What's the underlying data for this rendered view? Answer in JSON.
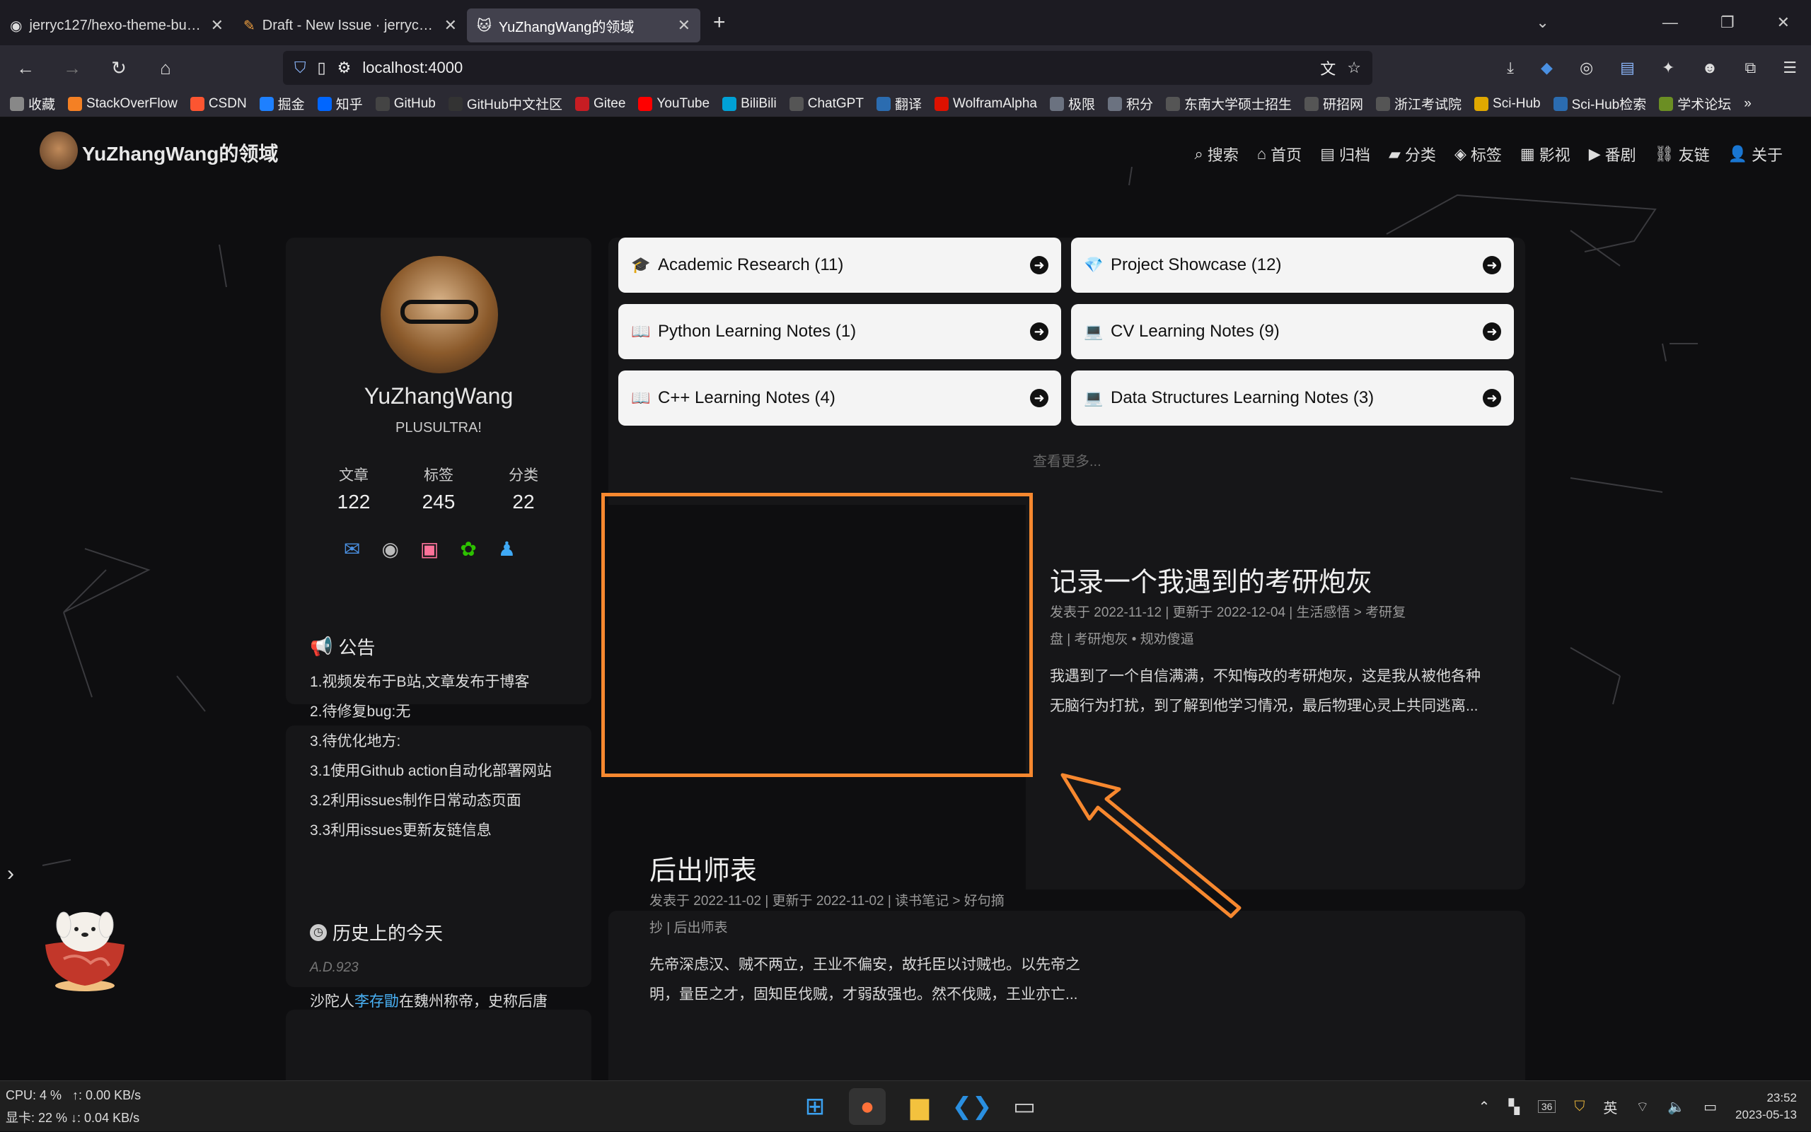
{
  "browser": {
    "tabs": [
      {
        "label": "jerryc127/hexo-theme-butterfly",
        "icon": "github-icon",
        "active": false
      },
      {
        "label": "Draft - New Issue · jerryc127/hexo-theme-butterfly",
        "icon": "pencil-icon",
        "active": false
      },
      {
        "label": "YuZhangWang的领域",
        "icon": "cat-icon",
        "active": true
      }
    ],
    "url": "localhost:4000",
    "bookmarks": [
      {
        "label": "收藏",
        "color": "#888"
      },
      {
        "label": "StackOverFlow",
        "color": "#f48024"
      },
      {
        "label": "CSDN",
        "color": "#fc5531"
      },
      {
        "label": "掘金",
        "color": "#1e80ff"
      },
      {
        "label": "知乎",
        "color": "#0066ff"
      },
      {
        "label": "GitHub",
        "color": "#444"
      },
      {
        "label": "GitHub中文社区",
        "color": "#333"
      },
      {
        "label": "Gitee",
        "color": "#c71d23"
      },
      {
        "label": "YouTube",
        "color": "#ff0000"
      },
      {
        "label": "BiliBili",
        "color": "#00a1d6"
      },
      {
        "label": "ChatGPT",
        "color": "#555"
      },
      {
        "label": "翻译",
        "color": "#2b6cb0"
      },
      {
        "label": "WolframAlpha",
        "color": "#dd1100"
      },
      {
        "label": "极限",
        "color": "#6b7280"
      },
      {
        "label": "积分",
        "color": "#6b7280"
      },
      {
        "label": "东南大学硕士招生",
        "color": "#555"
      },
      {
        "label": "研招网",
        "color": "#555"
      },
      {
        "label": "浙江考试院",
        "color": "#555"
      },
      {
        "label": "Sci-Hub",
        "color": "#e0a800"
      },
      {
        "label": "Sci-Hub检索",
        "color": "#2b6cb0"
      },
      {
        "label": "学术论坛",
        "color": "#6b8e23"
      }
    ]
  },
  "site": {
    "title": "YuZhangWang的领域",
    "menu": [
      {
        "label": "搜索",
        "icon": "search-icon",
        "glyph": "⌕"
      },
      {
        "label": "首页",
        "icon": "home-icon",
        "glyph": "⌂"
      },
      {
        "label": "归档",
        "icon": "archive-icon",
        "glyph": "▤"
      },
      {
        "label": "分类",
        "icon": "folder-icon",
        "glyph": "▰"
      },
      {
        "label": "标签",
        "icon": "tag-icon",
        "glyph": "◈"
      },
      {
        "label": "影视",
        "icon": "film-icon",
        "glyph": "▦"
      },
      {
        "label": "番剧",
        "icon": "tv-icon",
        "glyph": "▶"
      },
      {
        "label": "友链",
        "icon": "link-icon",
        "glyph": "⛓"
      },
      {
        "label": "关于",
        "icon": "user-icon",
        "glyph": "👤"
      }
    ]
  },
  "profile": {
    "name": "YuZhangWang",
    "motto": "PLUSULTRA!",
    "stats": [
      {
        "label": "文章",
        "value": "122"
      },
      {
        "label": "标签",
        "value": "245"
      },
      {
        "label": "分类",
        "value": "22"
      }
    ],
    "socials": [
      {
        "icon": "email-icon",
        "glyph": "✉",
        "color": "#4a90e2"
      },
      {
        "icon": "github-icon",
        "glyph": "◉",
        "color": "#bbbbbb"
      },
      {
        "icon": "bilibili-icon",
        "glyph": "▣",
        "color": "#fb7299"
      },
      {
        "icon": "wechat-icon",
        "glyph": "✿",
        "color": "#2dc100"
      },
      {
        "icon": "qq-icon",
        "glyph": "♟",
        "color": "#3fa9f5"
      }
    ]
  },
  "announcement": {
    "title": "公告",
    "lines": [
      "1.视频发布于B站,文章发布于博客",
      "2.待修复bug:无",
      "3.待优化地方:",
      "3.1使用Github action自动化部署网站",
      "3.2利用issues制作日常动态页面",
      "3.3利用issues更新友链信息"
    ]
  },
  "history": {
    "title": "历史上的今天",
    "date": "A.D.923",
    "text_prefix": "沙陀人",
    "text_link": "李存勖",
    "text_suffix": "在魏州称帝，史称后唐"
  },
  "categories": [
    {
      "label": "Academic Research (11)",
      "icon": "graduation-cap-icon",
      "glyph": "🎓"
    },
    {
      "label": "Project Showcase (12)",
      "icon": "gem-icon",
      "glyph": "💎"
    },
    {
      "label": "Python Learning Notes (1)",
      "icon": "book-icon",
      "glyph": "📖"
    },
    {
      "label": "CV Learning Notes (9)",
      "icon": "monitor-icon",
      "glyph": "💻"
    },
    {
      "label": "C++ Learning Notes (4)",
      "icon": "book-icon",
      "glyph": "📖"
    },
    {
      "label": "Data Structures Learning Notes (3)",
      "icon": "monitor-icon",
      "glyph": "💻"
    }
  ],
  "more_label": "查看更多...",
  "posts": [
    {
      "title": "记录一个我遇到的考研炮灰",
      "meta1": "发表于 2022-11-12 | 更新于 2022-12-04 | 生活感悟 > 考研复",
      "meta2": "盘 | 考研炮灰 • 规劝傻逼",
      "excerpt1": "我遇到了一个自信满满，不知悔改的考研炮灰，这是我从被他各种",
      "excerpt2": "无脑行为打扰，到了解到他学习情况，最后物理心灵上共同逃离..."
    },
    {
      "title": "后出师表",
      "meta1": "发表于 2022-11-02 | 更新于 2022-11-02 | 读书笔记 > 好句摘",
      "meta2": "抄 | 后出师表",
      "excerpt1": "先帝深虑汉、贼不两立，王业不偏安，故托臣以讨贼也。以先帝之",
      "excerpt2": "明，量臣之才，固知臣伐贼，才弱敌强也。然不伐贼，王业亦亡..."
    }
  ],
  "taskbar": {
    "cpu": "CPU: 4 %",
    "up": "↑: 0.00 KB/s",
    "gpu": "显卡: 22 %",
    "down": "↓: 0.04 KB/s",
    "ime": "英",
    "time": "23:52",
    "date": "2023-05-13",
    "badge": "36"
  }
}
